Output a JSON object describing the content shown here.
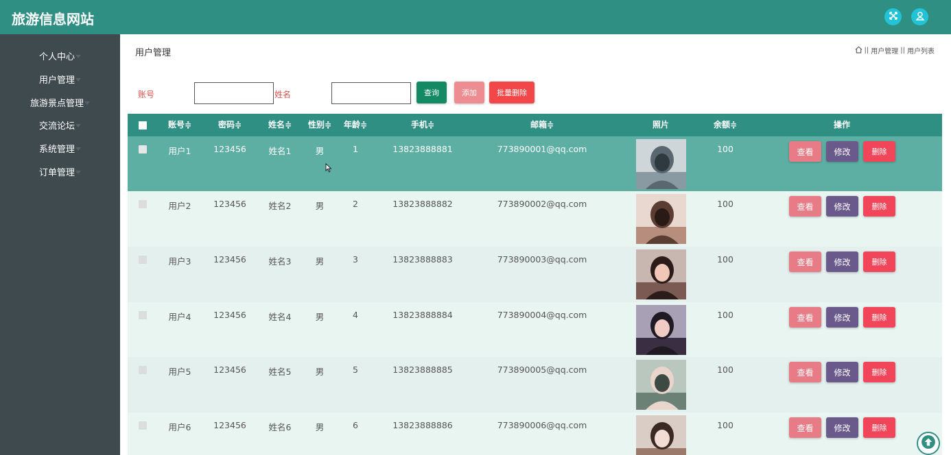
{
  "app": {
    "title": "旅游信息网站"
  },
  "topbar": {
    "icons": [
      "fullscreen-icon",
      "user-icon"
    ],
    "accent": "#22c3d6"
  },
  "sidebar": {
    "items": [
      {
        "label": "个人中心"
      },
      {
        "label": "用户管理"
      },
      {
        "label": "旅游景点管理"
      },
      {
        "label": "交流论坛"
      },
      {
        "label": "系统管理"
      },
      {
        "label": "订单管理"
      }
    ]
  },
  "page": {
    "title": "用户管理",
    "breadcrumb": [
      "用户管理",
      "用户列表"
    ],
    "breadcrumb_sep": "||"
  },
  "search": {
    "account_label": "账号",
    "account_value": "",
    "name_label": "姓名",
    "name_value": "",
    "query_label": "查询",
    "add_label": "添加",
    "batch_delete_label": "批量删除"
  },
  "table": {
    "columns": [
      "账号",
      "密码",
      "姓名",
      "性别",
      "年龄",
      "手机",
      "邮箱",
      "照片",
      "余额",
      "操作"
    ],
    "sort_mark": "≑",
    "rows": [
      {
        "account": "用户1",
        "password": "123456",
        "name": "姓名1",
        "gender": "男",
        "age": "1",
        "phone": "13823888881",
        "email": "773890001@qq.com",
        "balance": "100"
      },
      {
        "account": "用户2",
        "password": "123456",
        "name": "姓名2",
        "gender": "男",
        "age": "2",
        "phone": "13823888882",
        "email": "773890002@qq.com",
        "balance": "100"
      },
      {
        "account": "用户3",
        "password": "123456",
        "name": "姓名3",
        "gender": "男",
        "age": "3",
        "phone": "13823888883",
        "email": "773890003@qq.com",
        "balance": "100"
      },
      {
        "account": "用户4",
        "password": "123456",
        "name": "姓名4",
        "gender": "男",
        "age": "4",
        "phone": "13823888884",
        "email": "773890004@qq.com",
        "balance": "100"
      },
      {
        "account": "用户5",
        "password": "123456",
        "name": "姓名5",
        "gender": "男",
        "age": "5",
        "phone": "13823888885",
        "email": "773890005@qq.com",
        "balance": "100"
      },
      {
        "account": "用户6",
        "password": "123456",
        "name": "姓名6",
        "gender": "男",
        "age": "6",
        "phone": "13823888886",
        "email": "773890006@qq.com",
        "balance": "100"
      }
    ],
    "actions": {
      "view": "查看",
      "edit": "修改",
      "delete": "删除"
    }
  },
  "colors": {
    "header": "#2f8f83",
    "selected_row": "#5eafa3",
    "row_light": "#e9f5f1",
    "row_alt": "#e4f0ee",
    "view_btn": "#e87c86",
    "edit_btn": "#6a5a8c",
    "delete_btn": "#f1465a",
    "query_btn": "#138a63",
    "add_btn": "#ee8d91",
    "batch_delete_btn": "#f24648"
  }
}
